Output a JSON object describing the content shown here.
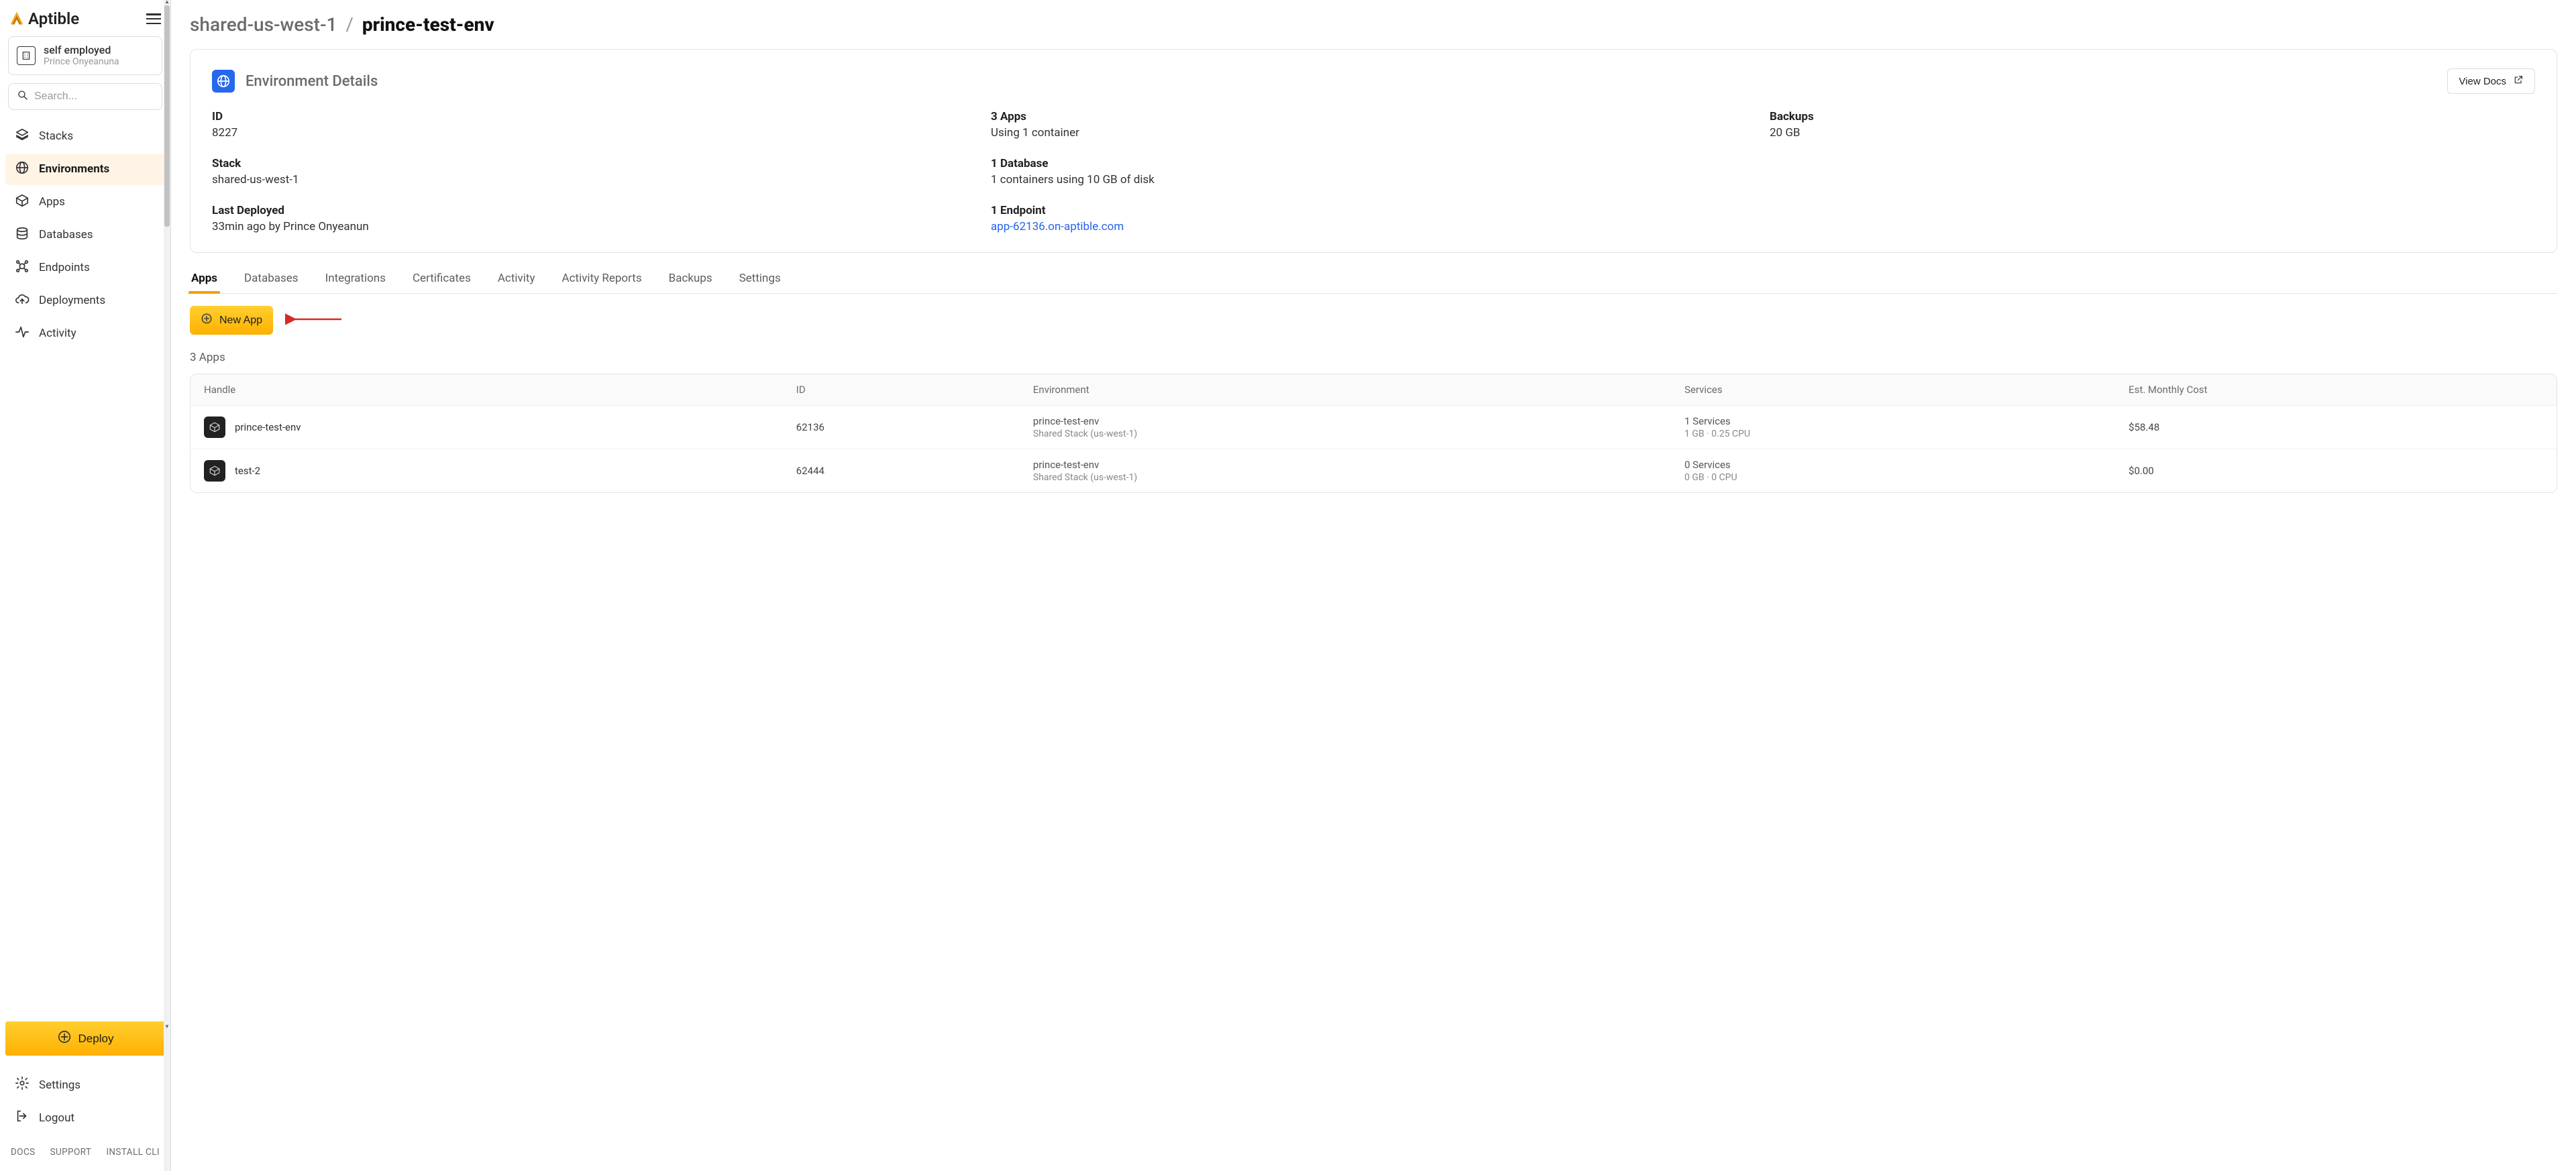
{
  "brand": "Aptible",
  "org": {
    "name": "self employed",
    "user": "Prince Onyeanuna"
  },
  "search": {
    "placeholder": "Search..."
  },
  "sidebar": {
    "items": [
      {
        "label": "Stacks",
        "icon": "stacks-icon"
      },
      {
        "label": "Environments",
        "icon": "globe-icon",
        "active": true
      },
      {
        "label": "Apps",
        "icon": "cube-icon"
      },
      {
        "label": "Databases",
        "icon": "database-icon"
      },
      {
        "label": "Endpoints",
        "icon": "endpoints-icon"
      },
      {
        "label": "Deployments",
        "icon": "cloud-up-icon"
      },
      {
        "label": "Activity",
        "icon": "activity-icon"
      }
    ],
    "deploy_label": "Deploy",
    "bottom": [
      {
        "label": "Settings",
        "icon": "gear-icon"
      },
      {
        "label": "Logout",
        "icon": "logout-icon"
      }
    ],
    "footer": {
      "docs": "DOCS",
      "support": "SUPPORT",
      "cli": "INSTALL CLI"
    }
  },
  "breadcrumb": {
    "parent": "shared-us-west-1",
    "current": "prince-test-env"
  },
  "card": {
    "title": "Environment Details",
    "view_docs_label": "View Docs",
    "details": {
      "id_label": "ID",
      "id_value": "8227",
      "apps_label": "3 Apps",
      "apps_value": "Using 1 container",
      "backups_label": "Backups",
      "backups_value": "20 GB",
      "stack_label": "Stack",
      "stack_value": "shared-us-west-1",
      "db_label": "1 Database",
      "db_value": "1 containers using 10 GB of disk",
      "deployed_label": "Last Deployed",
      "deployed_value": "33min ago by Prince Onyeanun",
      "endpoint_label": "1 Endpoint",
      "endpoint_link": "app-62136.on-aptible.com"
    }
  },
  "tabs": {
    "items": [
      {
        "label": "Apps",
        "active": true
      },
      {
        "label": "Databases"
      },
      {
        "label": "Integrations"
      },
      {
        "label": "Certificates"
      },
      {
        "label": "Activity"
      },
      {
        "label": "Activity Reports"
      },
      {
        "label": "Backups"
      },
      {
        "label": "Settings"
      }
    ]
  },
  "new_app_label": "New App",
  "apps_count_label": "3 Apps",
  "table": {
    "headers": {
      "handle": "Handle",
      "id": "ID",
      "env": "Environment",
      "services": "Services",
      "cost": "Est. Monthly Cost"
    },
    "rows": [
      {
        "handle": "prince-test-env",
        "id": "62136",
        "env_line1": "prince-test-env",
        "env_line2": "Shared Stack (us-west-1)",
        "svc_line1": "1 Services",
        "svc_line2": "1 GB · 0.25 CPU",
        "cost": "$58.48"
      },
      {
        "handle": "test-2",
        "id": "62444",
        "env_line1": "prince-test-env",
        "env_line2": "Shared Stack (us-west-1)",
        "svc_line1": "0 Services",
        "svc_line2": "0 GB · 0 CPU",
        "cost": "$0.00"
      }
    ]
  }
}
